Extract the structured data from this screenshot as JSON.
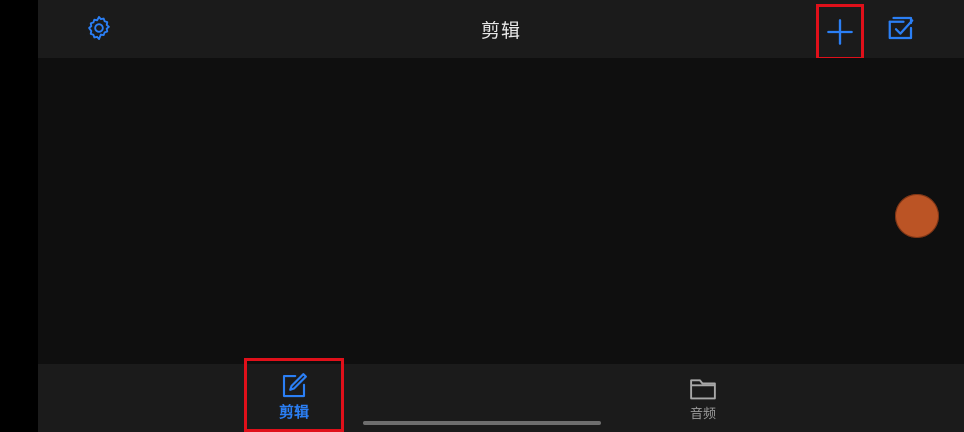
{
  "header": {
    "title": "剪辑",
    "settings_icon": "gear-icon",
    "add_icon": "plus-icon",
    "select_icon": "checkbox-select-icon"
  },
  "tabs": [
    {
      "label": "剪辑",
      "icon": "edit-icon",
      "active": true
    },
    {
      "label": "音频",
      "icon": "folder-icon",
      "active": false
    }
  ],
  "colors": {
    "accent": "#2b7ff5",
    "highlight_box": "#e0101a",
    "background": "#0f0f0f",
    "bar": "#1b1b1b",
    "inactive_tab": "#9a9a9a",
    "floating_ball": "#d9612a"
  }
}
